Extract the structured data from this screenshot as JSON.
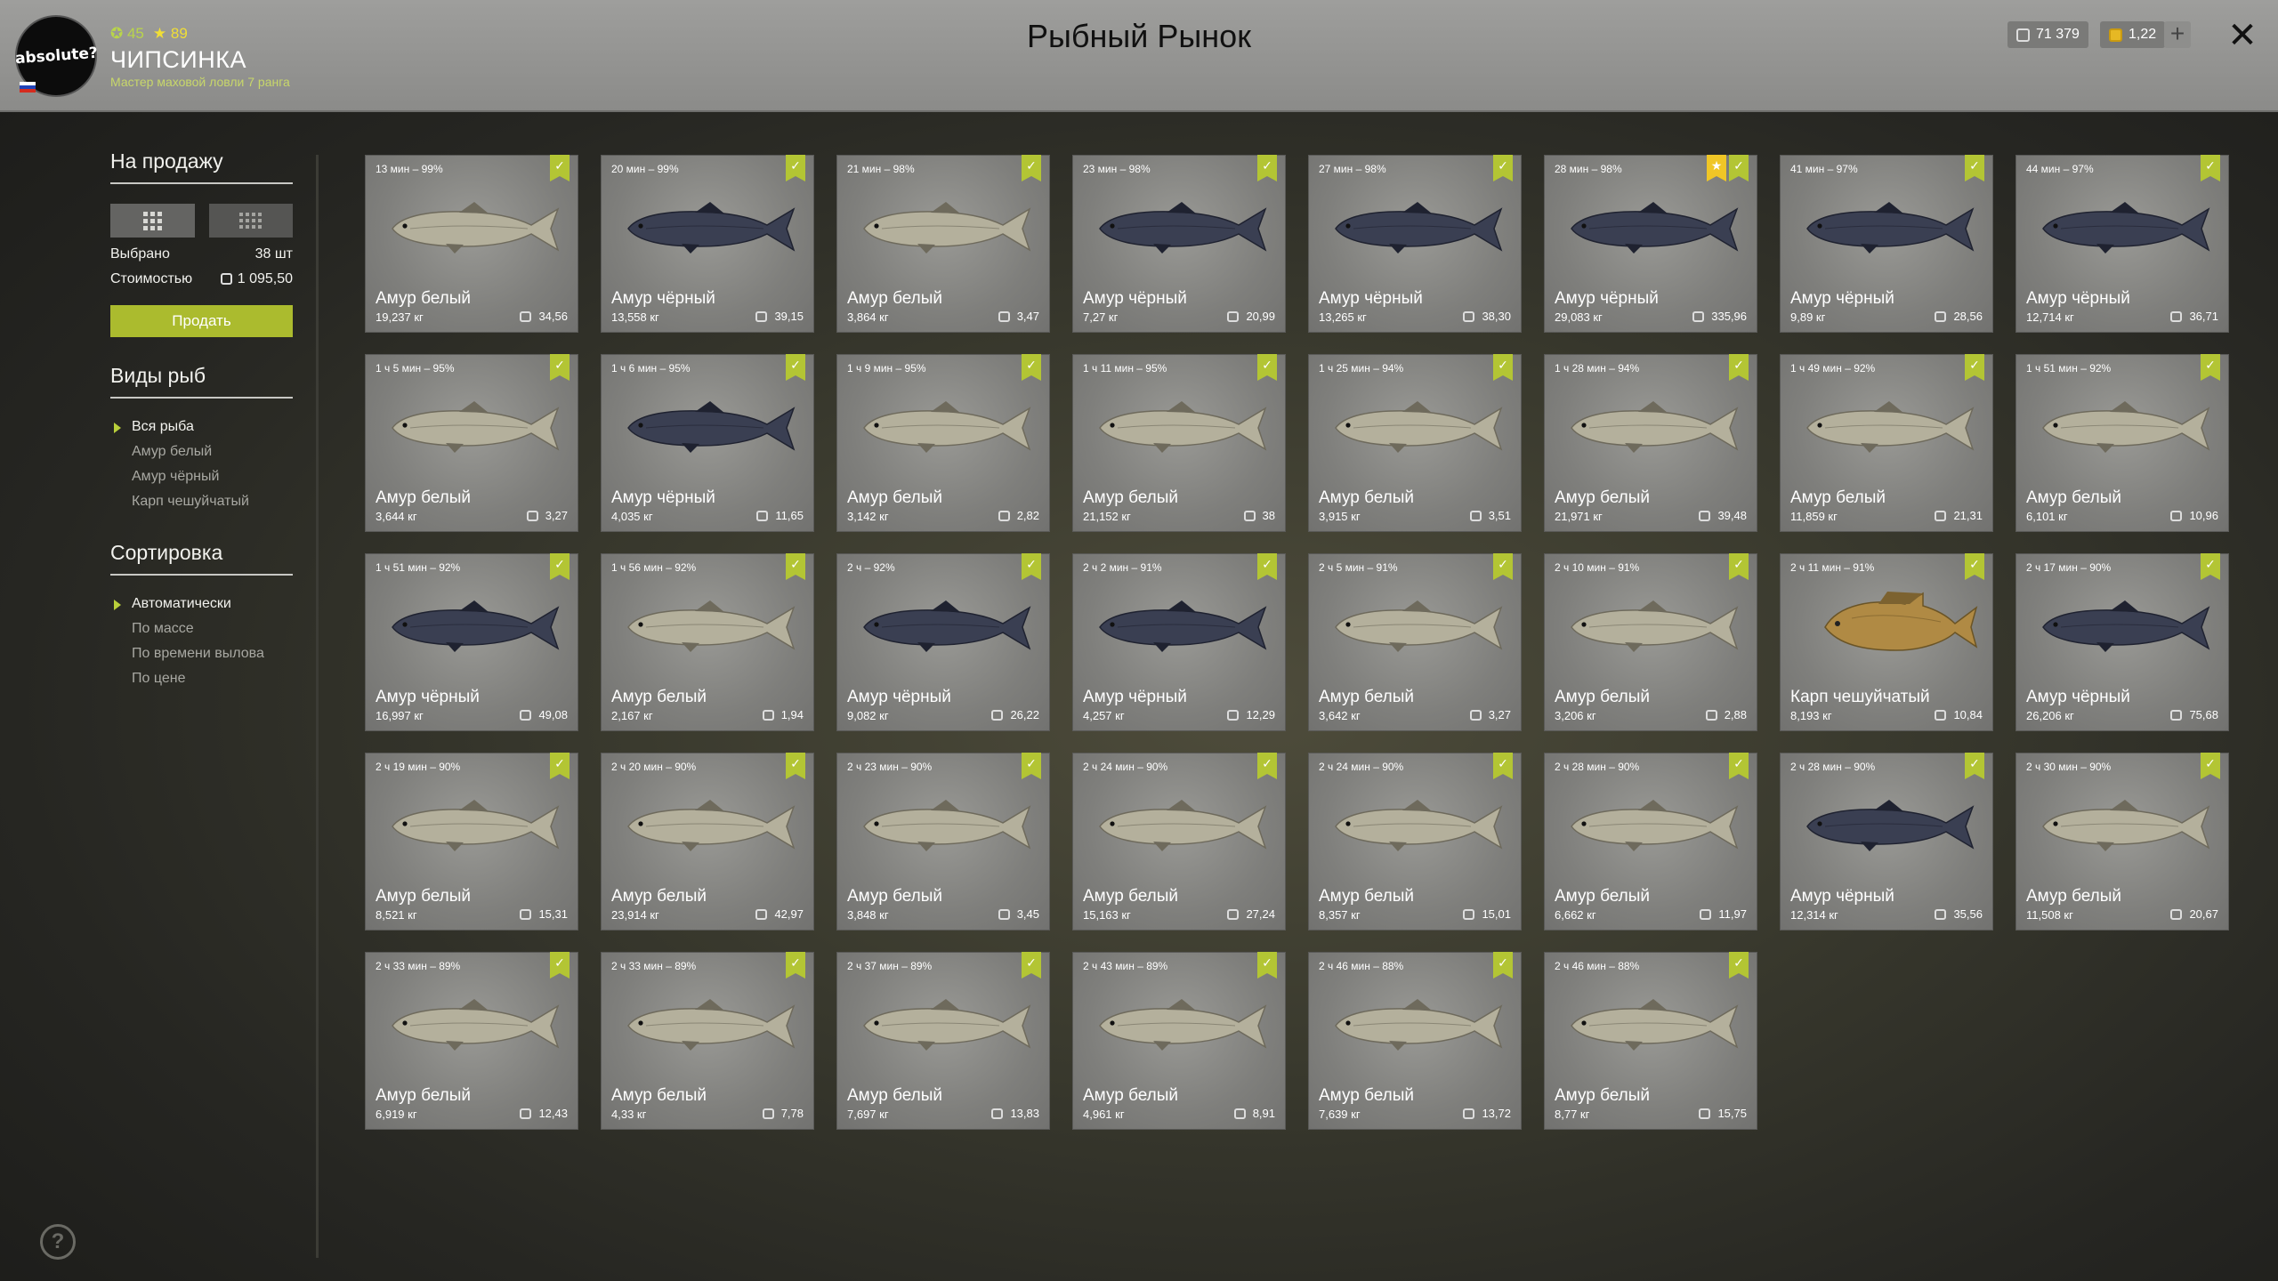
{
  "header": {
    "avatar_text": "absolute?",
    "level": "45",
    "rank_stars": "89",
    "player_name": "ЧИПСИНКА",
    "player_rank": "Мастер маховой ловли 7 ранга",
    "title": "Рыбный Рынок",
    "silver": "71 379",
    "gold": "1,22",
    "plus_symbol": "+",
    "close_symbol": "✕"
  },
  "sidebar": {
    "for_sale_title": "На продажу",
    "selected_label": "Выбрано",
    "selected_value": "38 шт",
    "cost_label": "Стоимостью",
    "cost_value": "1 095,50",
    "sell_button": "Продать",
    "species_title": "Виды рыб",
    "species": [
      "Вся рыба",
      "Амур белый",
      "Амур чёрный",
      "Карп чешуйчатый"
    ],
    "sort_title": "Сортировка",
    "sort_options": [
      "Автоматически",
      "По массе",
      "По времени вылова",
      "По цене"
    ],
    "help_symbol": "?"
  },
  "colors": {
    "accent": "#abbb2e",
    "bookmark": "#b3c534",
    "star": "#f0c626",
    "white_amur": "#b4b09c",
    "black_amur": "#3a3f52",
    "carp": "#b08a44"
  },
  "fish": [
    {
      "time": "13 мин – 99%",
      "name": "Амур белый",
      "weight": "19,237 кг",
      "price": "34,56",
      "kind": "white"
    },
    {
      "time": "20 мин – 99%",
      "name": "Амур чёрный",
      "weight": "13,558 кг",
      "price": "39,15",
      "kind": "black"
    },
    {
      "time": "21 мин – 98%",
      "name": "Амур белый",
      "weight": "3,864 кг",
      "price": "3,47",
      "kind": "white"
    },
    {
      "time": "23 мин – 98%",
      "name": "Амур чёрный",
      "weight": "7,27 кг",
      "price": "20,99",
      "kind": "black"
    },
    {
      "time": "27 мин – 98%",
      "name": "Амур чёрный",
      "weight": "13,265 кг",
      "price": "38,30",
      "kind": "black"
    },
    {
      "time": "28 мин – 98%",
      "name": "Амур чёрный",
      "weight": "29,083 кг",
      "price": "335,96",
      "kind": "black",
      "star": true
    },
    {
      "time": "41 мин – 97%",
      "name": "Амур чёрный",
      "weight": "9,89 кг",
      "price": "28,56",
      "kind": "black"
    },
    {
      "time": "44 мин – 97%",
      "name": "Амур чёрный",
      "weight": "12,714 кг",
      "price": "36,71",
      "kind": "black"
    },
    {
      "time": "1 ч 5 мин – 95%",
      "name": "Амур белый",
      "weight": "3,644 кг",
      "price": "3,27",
      "kind": "white"
    },
    {
      "time": "1 ч 6 мин – 95%",
      "name": "Амур чёрный",
      "weight": "4,035 кг",
      "price": "11,65",
      "kind": "black"
    },
    {
      "time": "1 ч 9 мин – 95%",
      "name": "Амур белый",
      "weight": "3,142 кг",
      "price": "2,82",
      "kind": "white"
    },
    {
      "time": "1 ч 11 мин – 95%",
      "name": "Амур белый",
      "weight": "21,152 кг",
      "price": "38",
      "kind": "white"
    },
    {
      "time": "1 ч 25 мин – 94%",
      "name": "Амур белый",
      "weight": "3,915 кг",
      "price": "3,51",
      "kind": "white"
    },
    {
      "time": "1 ч 28 мин – 94%",
      "name": "Амур белый",
      "weight": "21,971 кг",
      "price": "39,48",
      "kind": "white"
    },
    {
      "time": "1 ч 49 мин – 92%",
      "name": "Амур белый",
      "weight": "11,859 кг",
      "price": "21,31",
      "kind": "white"
    },
    {
      "time": "1 ч 51 мин – 92%",
      "name": "Амур белый",
      "weight": "6,101 кг",
      "price": "10,96",
      "kind": "white"
    },
    {
      "time": "1 ч 51 мин – 92%",
      "name": "Амур чёрный",
      "weight": "16,997 кг",
      "price": "49,08",
      "kind": "black"
    },
    {
      "time": "1 ч 56 мин – 92%",
      "name": "Амур белый",
      "weight": "2,167 кг",
      "price": "1,94",
      "kind": "white"
    },
    {
      "time": "2 ч – 92%",
      "name": "Амур чёрный",
      "weight": "9,082 кг",
      "price": "26,22",
      "kind": "black"
    },
    {
      "time": "2 ч 2 мин – 91%",
      "name": "Амур чёрный",
      "weight": "4,257 кг",
      "price": "12,29",
      "kind": "black"
    },
    {
      "time": "2 ч 5 мин – 91%",
      "name": "Амур белый",
      "weight": "3,642 кг",
      "price": "3,27",
      "kind": "white"
    },
    {
      "time": "2 ч 10 мин – 91%",
      "name": "Амур белый",
      "weight": "3,206 кг",
      "price": "2,88",
      "kind": "white"
    },
    {
      "time": "2 ч 11 мин – 91%",
      "name": "Карп чешуйчатый",
      "weight": "8,193 кг",
      "price": "10,84",
      "kind": "carp"
    },
    {
      "time": "2 ч 17 мин – 90%",
      "name": "Амур чёрный",
      "weight": "26,206 кг",
      "price": "75,68",
      "kind": "black"
    },
    {
      "time": "2 ч 19 мин – 90%",
      "name": "Амур белый",
      "weight": "8,521 кг",
      "price": "15,31",
      "kind": "white"
    },
    {
      "time": "2 ч 20 мин – 90%",
      "name": "Амур белый",
      "weight": "23,914 кг",
      "price": "42,97",
      "kind": "white"
    },
    {
      "time": "2 ч 23 мин – 90%",
      "name": "Амур белый",
      "weight": "3,848 кг",
      "price": "3,45",
      "kind": "white"
    },
    {
      "time": "2 ч 24 мин – 90%",
      "name": "Амур белый",
      "weight": "15,163 кг",
      "price": "27,24",
      "kind": "white"
    },
    {
      "time": "2 ч 24 мин – 90%",
      "name": "Амур белый",
      "weight": "8,357 кг",
      "price": "15,01",
      "kind": "white"
    },
    {
      "time": "2 ч 28 мин – 90%",
      "name": "Амур белый",
      "weight": "6,662 кг",
      "price": "11,97",
      "kind": "white"
    },
    {
      "time": "2 ч 28 мин – 90%",
      "name": "Амур чёрный",
      "weight": "12,314 кг",
      "price": "35,56",
      "kind": "black"
    },
    {
      "time": "2 ч 30 мин – 90%",
      "name": "Амур белый",
      "weight": "11,508 кг",
      "price": "20,67",
      "kind": "white"
    },
    {
      "time": "2 ч 33 мин – 89%",
      "name": "Амур белый",
      "weight": "6,919 кг",
      "price": "12,43",
      "kind": "white"
    },
    {
      "time": "2 ч 33 мин – 89%",
      "name": "Амур белый",
      "weight": "4,33 кг",
      "price": "7,78",
      "kind": "white"
    },
    {
      "time": "2 ч 37 мин – 89%",
      "name": "Амур белый",
      "weight": "7,697 кг",
      "price": "13,83",
      "kind": "white"
    },
    {
      "time": "2 ч 43 мин – 89%",
      "name": "Амур белый",
      "weight": "4,961 кг",
      "price": "8,91",
      "kind": "white"
    },
    {
      "time": "2 ч 46 мин – 88%",
      "name": "Амур белый",
      "weight": "7,639 кг",
      "price": "13,72",
      "kind": "white"
    },
    {
      "time": "2 ч 46 мин – 88%",
      "name": "Амур белый",
      "weight": "8,77 кг",
      "price": "15,75",
      "kind": "white"
    }
  ]
}
